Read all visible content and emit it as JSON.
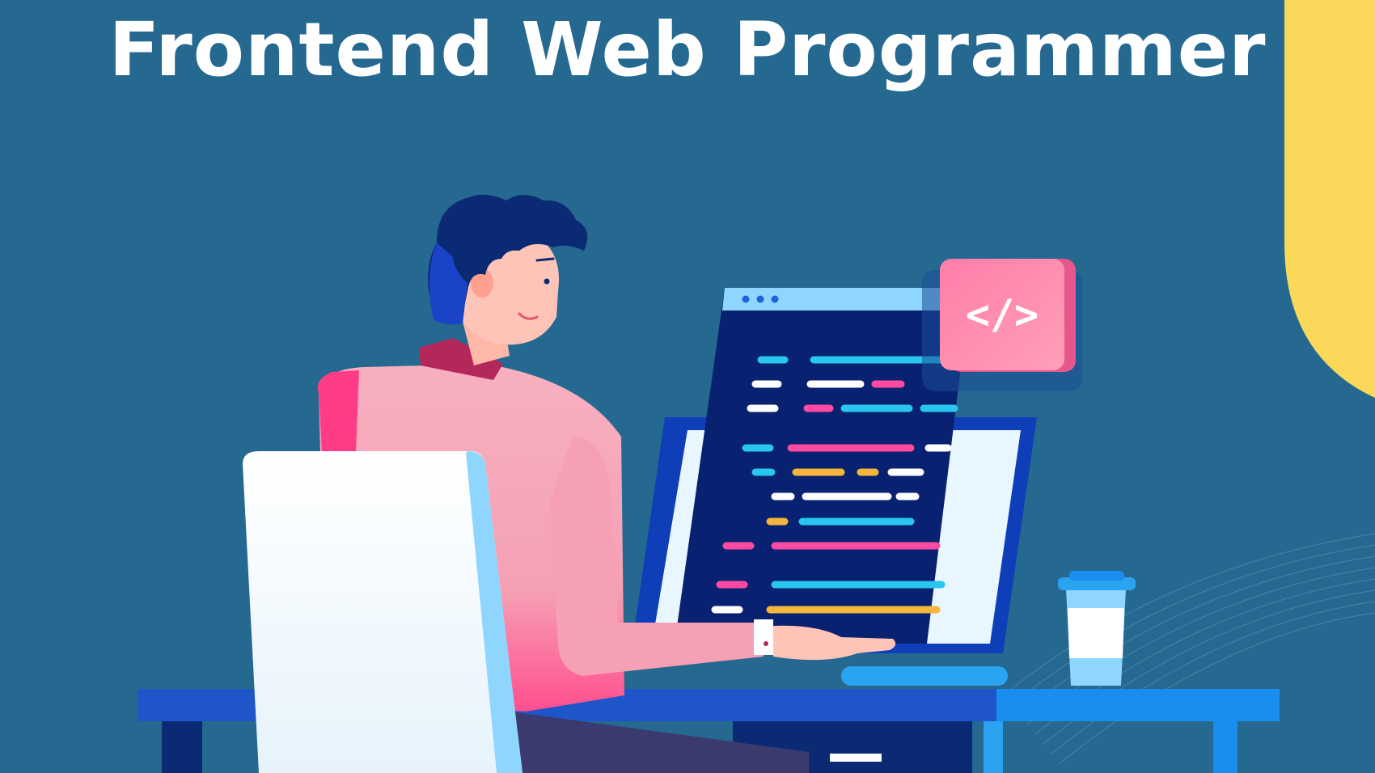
{
  "title": "Frontend Web Programmer",
  "code_badge": {
    "label": "</>"
  },
  "colors": {
    "background": "#256890",
    "accent_yellow": "#f9d85a",
    "shirt_pink": "#f6a0b5",
    "monitor_navy": "#0b2a74",
    "desk_blue": "#1e55c8",
    "code_cyan": "#29c6f0",
    "code_pink": "#ff4aa3",
    "code_yellow": "#f5b63c",
    "code_white": "#ffffff"
  },
  "icons": [
    "window-dots-icon",
    "code-tag-icon",
    "coffee-cup-icon"
  ]
}
